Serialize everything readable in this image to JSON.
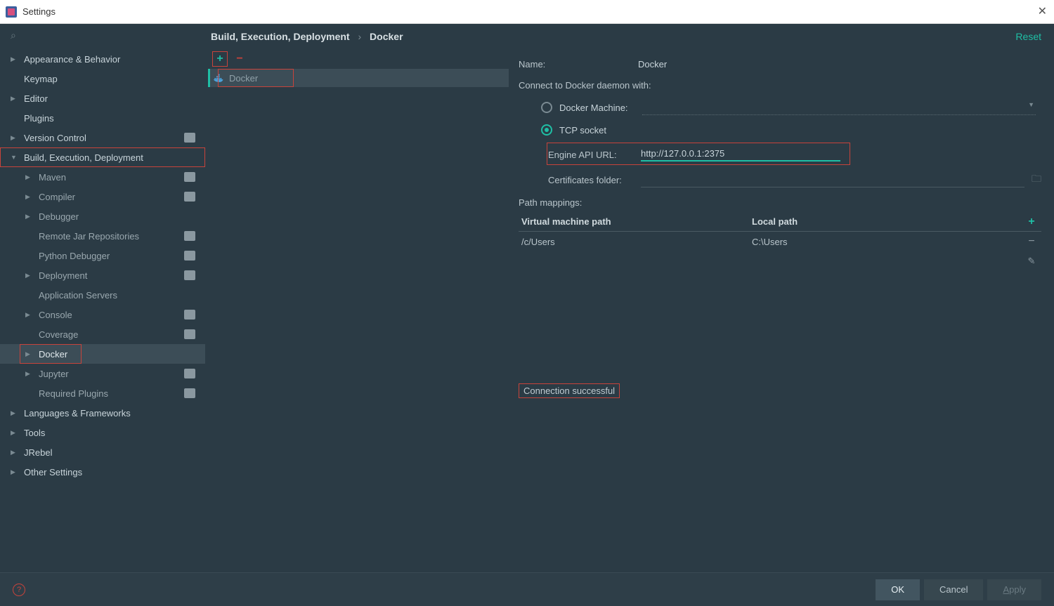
{
  "title": "Settings",
  "breadcrumb": {
    "root": "Build, Execution, Deployment",
    "leaf": "Docker"
  },
  "reset": "Reset",
  "sidebar": {
    "items": [
      {
        "label": "Appearance & Behavior",
        "arrow": "▶",
        "bold": true
      },
      {
        "label": "Keymap",
        "noarrow": true,
        "bold": true
      },
      {
        "label": "Editor",
        "arrow": "▶",
        "bold": true
      },
      {
        "label": "Plugins",
        "noarrow": true,
        "bold": true
      },
      {
        "label": "Version Control",
        "arrow": "▶",
        "bold": true,
        "proj": true
      },
      {
        "label": "Build, Execution, Deployment",
        "arrow": "▼",
        "bold": true,
        "red": true
      },
      {
        "label": "Maven",
        "arrow": "▶",
        "l": 1,
        "proj": true
      },
      {
        "label": "Compiler",
        "arrow": "▶",
        "l": 1,
        "proj": true
      },
      {
        "label": "Debugger",
        "arrow": "▶",
        "l": 1
      },
      {
        "label": "Remote Jar Repositories",
        "noarrow": true,
        "l": 1,
        "proj": true
      },
      {
        "label": "Python Debugger",
        "noarrow": true,
        "l": 1,
        "proj": true
      },
      {
        "label": "Deployment",
        "arrow": "▶",
        "l": 1,
        "proj": true
      },
      {
        "label": "Application Servers",
        "noarrow": true,
        "l": 1
      },
      {
        "label": "Console",
        "arrow": "▶",
        "l": 1,
        "proj": true
      },
      {
        "label": "Coverage",
        "noarrow": true,
        "l": 1,
        "proj": true
      },
      {
        "label": "Docker",
        "arrow": "▶",
        "l": 1,
        "selected": true,
        "bold": true,
        "red": true
      },
      {
        "label": "Jupyter",
        "arrow": "▶",
        "l": 1,
        "proj": true
      },
      {
        "label": "Required Plugins",
        "noarrow": true,
        "l": 1,
        "proj": true
      },
      {
        "label": "Languages & Frameworks",
        "arrow": "▶",
        "bold": true
      },
      {
        "label": "Tools",
        "arrow": "▶",
        "bold": true
      },
      {
        "label": "JRebel",
        "arrow": "▶",
        "bold": true
      },
      {
        "label": "Other Settings",
        "arrow": "▶",
        "bold": true
      }
    ]
  },
  "list": {
    "item": "Docker"
  },
  "detail": {
    "name_lbl": "Name:",
    "name_val": "Docker",
    "connect_lbl": "Connect to Docker daemon with:",
    "radio_dm": "Docker Machine:",
    "radio_tcp": "TCP socket",
    "api_lbl": "Engine API URL:",
    "api_val": "http://127.0.0.1:2375",
    "cert_lbl": "Certificates folder:",
    "path_lbl": "Path mappings:",
    "col_vm": "Virtual machine path",
    "col_local": "Local path",
    "row_vm": "/c/Users",
    "row_local": "C:\\Users",
    "status": "Connection successful"
  },
  "footer": {
    "ok": "OK",
    "cancel": "Cancel",
    "apply": "Apply"
  }
}
